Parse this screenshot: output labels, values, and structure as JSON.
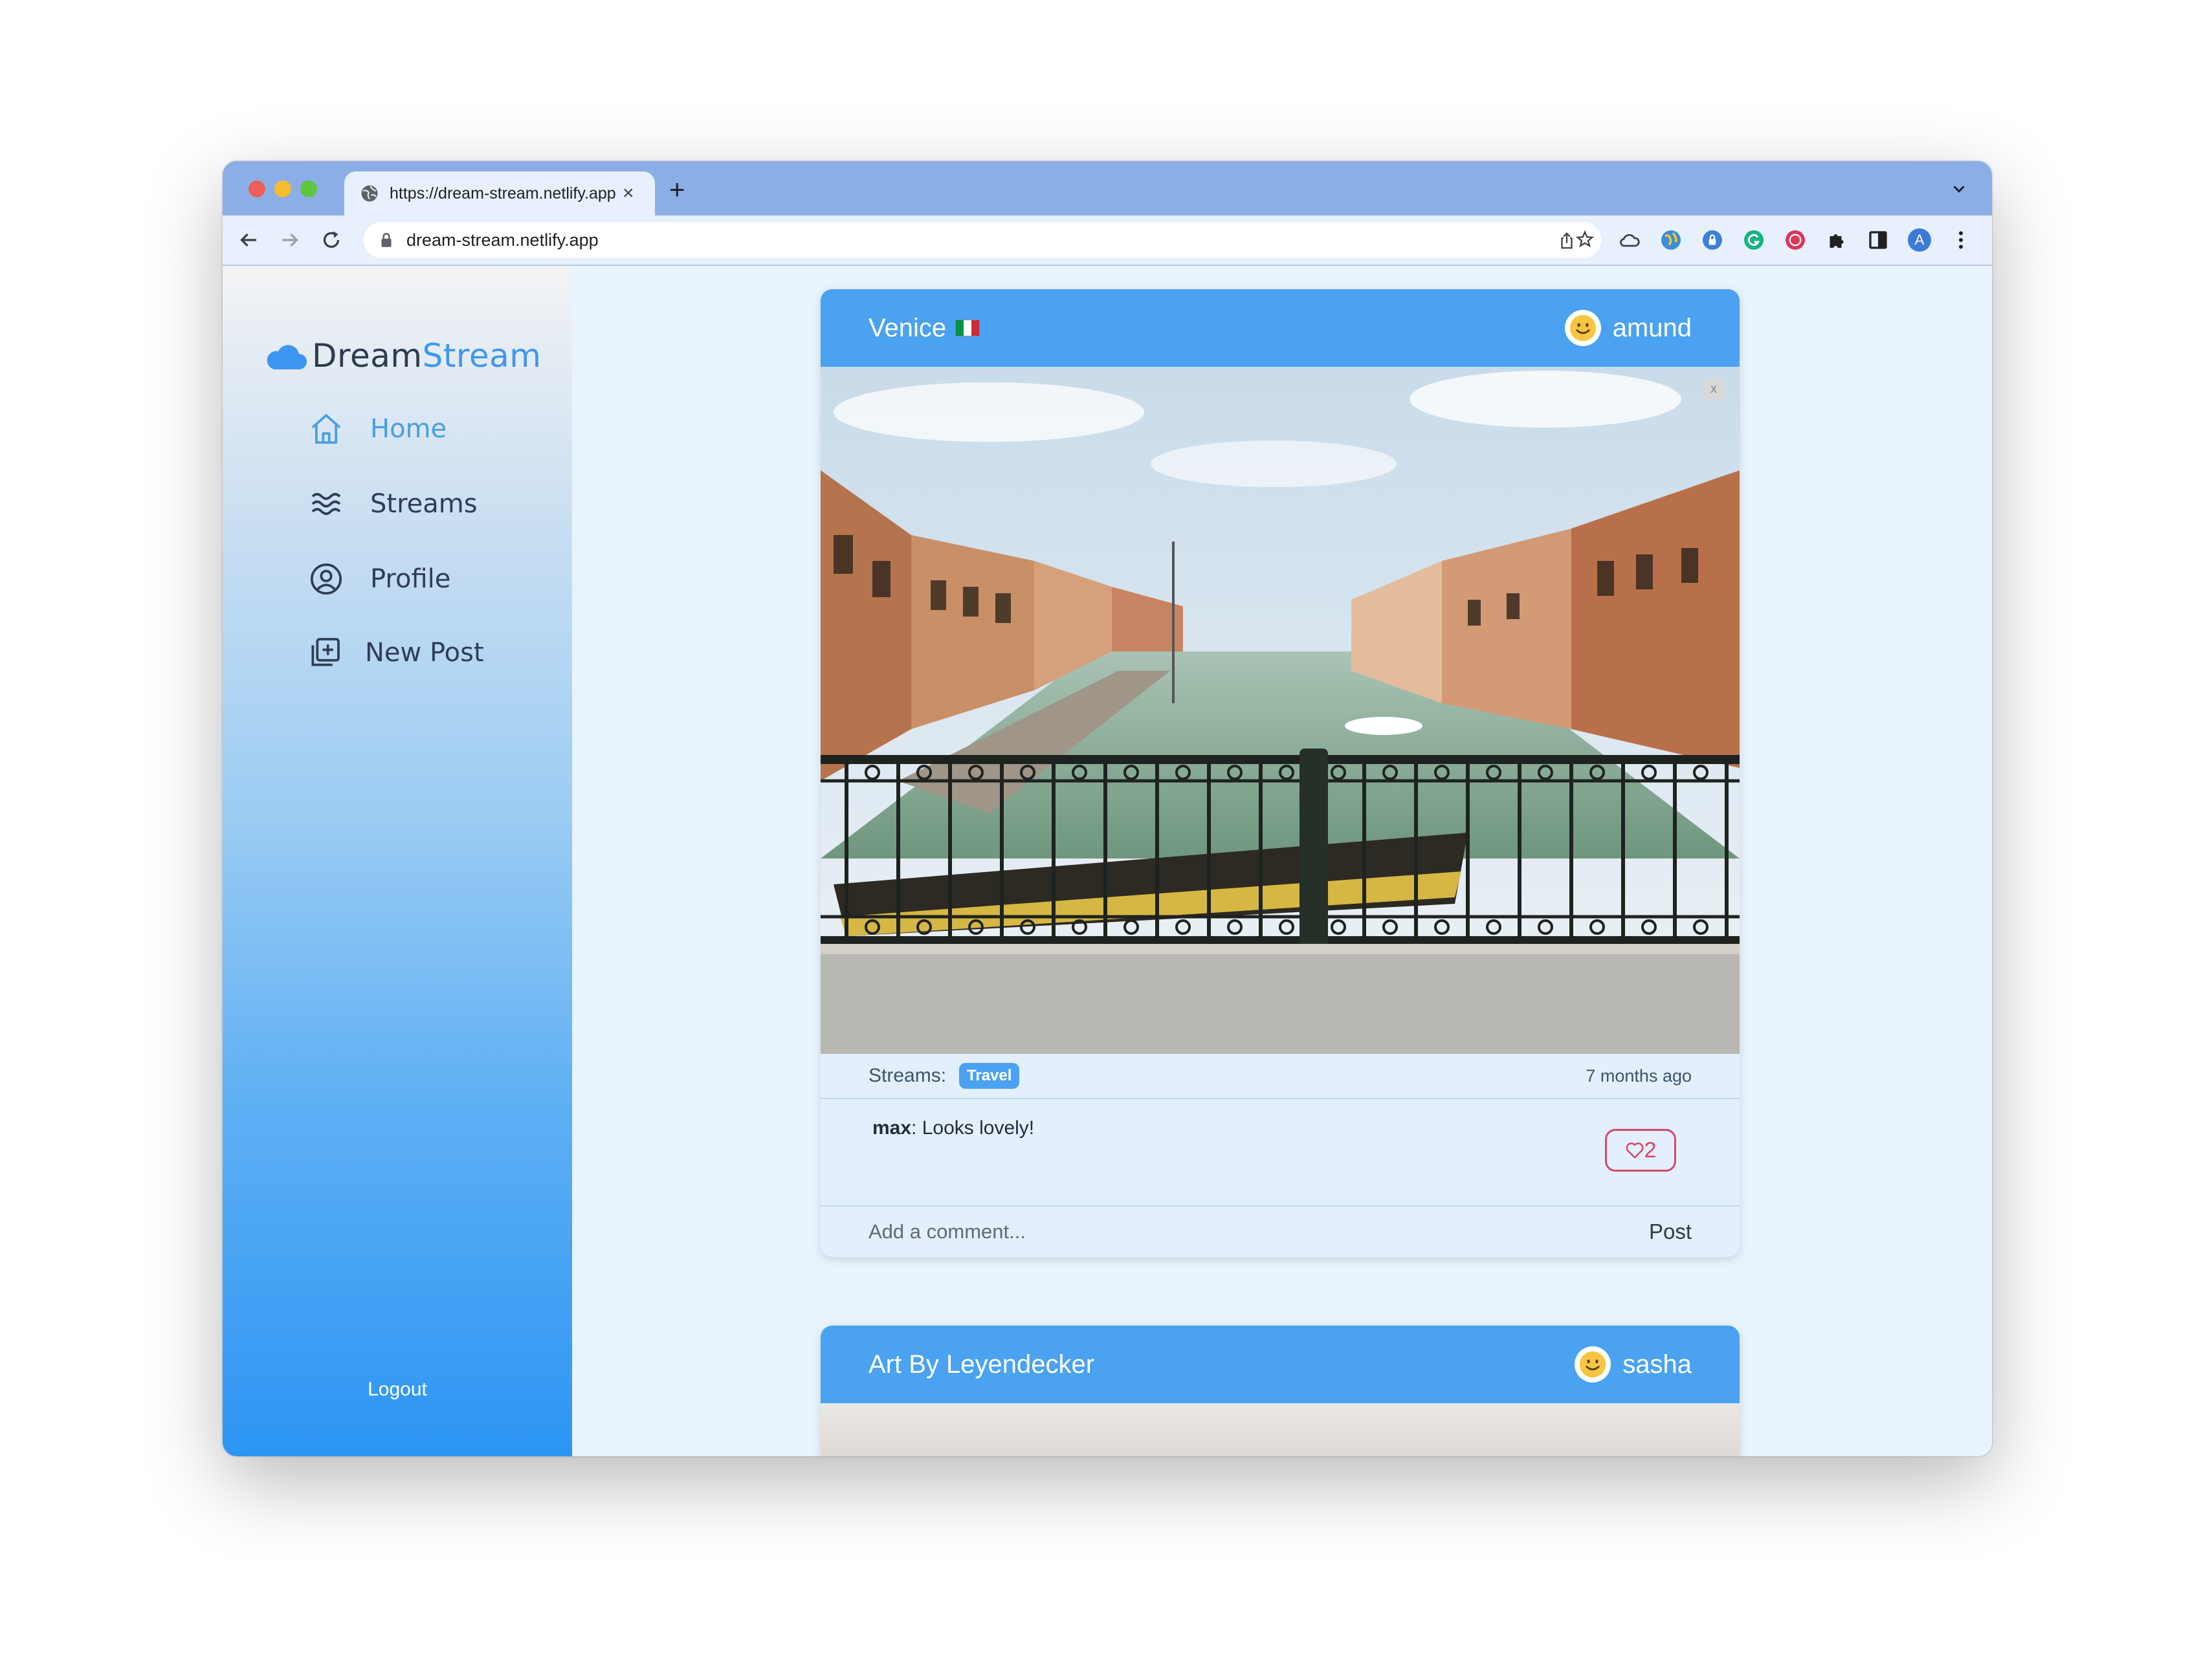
{
  "browser": {
    "tab_title": "https://dream-stream.netlify.app",
    "tab_close": "×",
    "new_tab": "+",
    "url": "dream-stream.netlify.app",
    "profile_initial": "A"
  },
  "sidebar": {
    "logo_part1": "Dream",
    "logo_part2": "Stream",
    "items": [
      {
        "label": "Home",
        "icon": "home-icon",
        "active": true
      },
      {
        "label": "Streams",
        "icon": "waves-icon",
        "active": false
      },
      {
        "label": "Profile",
        "icon": "user-circle-icon",
        "active": false
      },
      {
        "label": "New Post",
        "icon": "add-post-icon",
        "active": false
      }
    ],
    "logout": "Logout"
  },
  "posts": [
    {
      "title": "Venice",
      "flag": "italy-flag",
      "user": "amund",
      "streams_label": "Streams:",
      "stream_badge": "Travel",
      "time": "7 months ago",
      "comment_user": "max",
      "comment_text": ": Looks lovely!",
      "likes": "2",
      "comment_placeholder": "Add a comment...",
      "post_label": "Post",
      "close": "x"
    },
    {
      "title": "Art By Leyendecker",
      "user": "sasha"
    }
  ],
  "colors": {
    "accent": "#4aa2f1",
    "like": "#d9456a",
    "tabstrip": "#8caee6"
  }
}
